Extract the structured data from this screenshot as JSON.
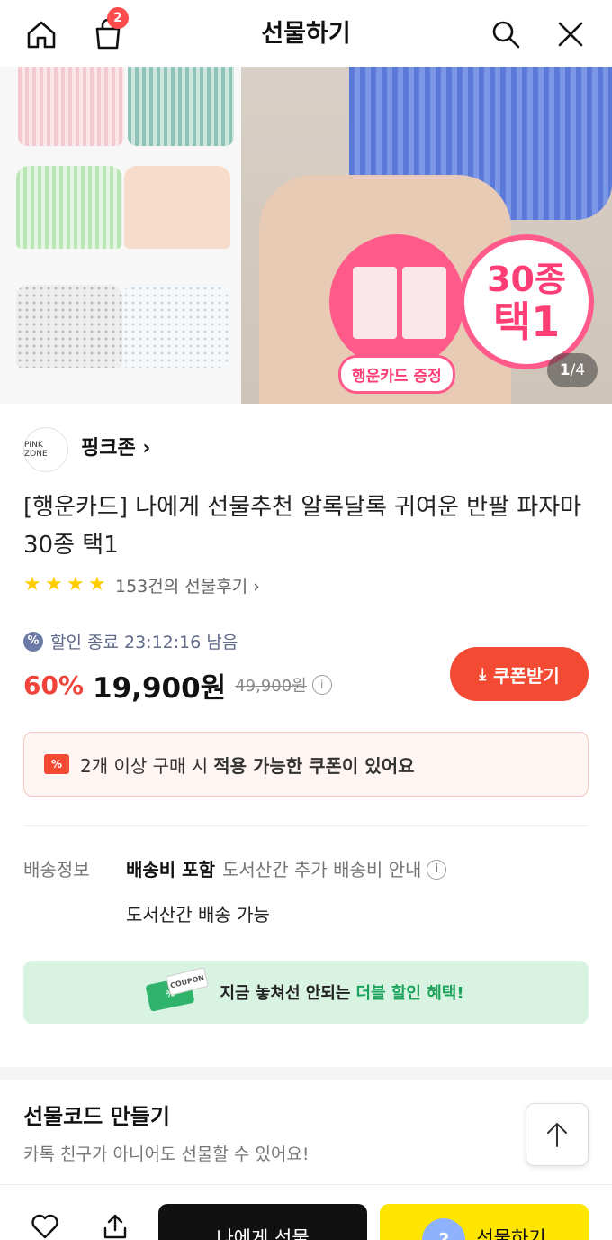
{
  "header": {
    "title": "선물하기",
    "cart_badge": "2",
    "icons": [
      "home-icon",
      "shopping-bag-icon",
      "search-icon",
      "close-icon"
    ]
  },
  "hero": {
    "promo_top": "30종",
    "promo_bottom": "택1",
    "gift_card_label": "행운카드 증정",
    "pager_current": "1",
    "pager_total": "/4"
  },
  "seller": {
    "logo_text": "PINK ZONE",
    "name": "핑크존",
    "chevron": "›"
  },
  "product": {
    "title": "[행운카드] 나에게 선물추천 알록달록 귀여운 반팔 파자마 30종 택1",
    "rating_stars": 4,
    "review_text": "153건의 선물후기",
    "review_chevron": "›"
  },
  "pricing": {
    "timer_text": "할인 종료 23:12:16 남음",
    "discount": "60%",
    "price": "19,900원",
    "original_price": "49,900원",
    "coupon_button": "쿠폰받기"
  },
  "coupon_notice": {
    "text_plain": "2개 이상 구매 시",
    "text_bold": "적용 가능한 쿠폰이 있어요"
  },
  "shipping": {
    "label": "배송정보",
    "included": "배송비 포함",
    "extra": "도서산간 추가 배송비 안내",
    "remote": "도서산간 배송 가능"
  },
  "double_banner": {
    "text_plain": "지금 놓쳐선 안되는",
    "text_green": "더블 할인 혜택!",
    "coupon_art_label": "COUPON"
  },
  "gift_code": {
    "title": "선물코드 만들기",
    "subtitle": "카톡 친구가 아니어도 선물할 수 있어요!"
  },
  "bottom_bar": {
    "self_button": "나에게 선물",
    "gift_button": "선물하기",
    "gift_circle": "?"
  },
  "colors": {
    "accent_red": "#f24a33",
    "accent_yellow": "#ffe600",
    "accent_pink": "#ff5a8a",
    "accent_green": "#1aa35a"
  }
}
